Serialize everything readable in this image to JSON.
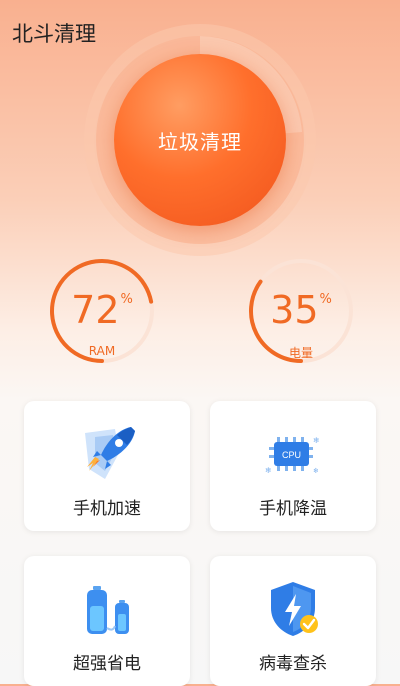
{
  "app": {
    "title": "北斗清理"
  },
  "main_button": {
    "label": "垃圾清理"
  },
  "gauges": [
    {
      "value": "72",
      "unit": "%",
      "label": "RAM",
      "fill": 0.72
    },
    {
      "value": "35",
      "unit": "%",
      "label": "电量",
      "fill": 0.35
    }
  ],
  "cards": [
    {
      "label": "手机加速",
      "icon": "rocket-icon"
    },
    {
      "label": "手机降温",
      "icon": "cpu-icon",
      "badge": "CPU"
    },
    {
      "label": "超强省电",
      "icon": "battery-icon"
    },
    {
      "label": "病毒查杀",
      "icon": "shield-icon"
    }
  ],
  "colors": {
    "accent": "#f06a24",
    "orb": "#ff6f2c"
  }
}
